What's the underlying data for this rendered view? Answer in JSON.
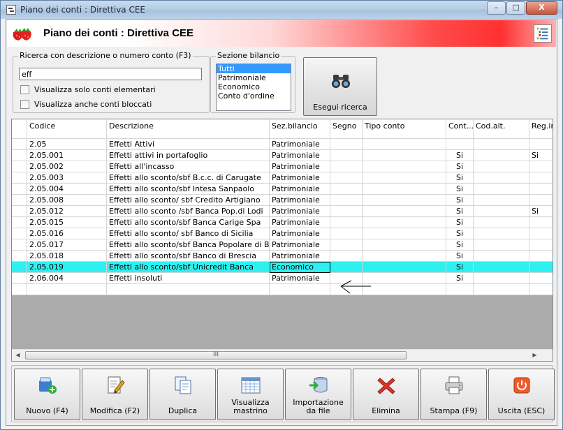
{
  "window": {
    "title": "Piano dei conti : Direttiva CEE",
    "controls": {
      "minimize": "–",
      "maximize": "□",
      "close": "X"
    }
  },
  "header": {
    "title": "Piano dei conti : Direttiva CEE"
  },
  "search": {
    "legend": "Ricerca con descrizione o numero conto (F3)",
    "value": "eff",
    "only_elementary_label": "Visualizza solo conti elementari",
    "show_blocked_label": "Visualizza anche conti bloccati"
  },
  "section": {
    "legend": "Sezione bilancio",
    "options": [
      "Tutti",
      "Patrimoniale",
      "Economico",
      "Conto d'ordine"
    ],
    "selected": "Tutti"
  },
  "search_button": {
    "label": "Esegui ricerca"
  },
  "grid": {
    "columns": [
      "Codice",
      "Descrizione",
      "Sez.bilancio",
      "Segno",
      "Tipo conto",
      "Cont...",
      "Cod.alt.",
      "Reg.ir"
    ],
    "rows": [
      [
        "2.05",
        "Effetti Attivi",
        "Patrimoniale",
        "",
        "",
        "",
        "",
        ""
      ],
      [
        "2.05.001",
        "Effetti attivi in portafoglio",
        "Patrimoniale",
        "",
        "",
        "Si",
        "",
        "Si"
      ],
      [
        "2.05.002",
        "Effetti all'incasso",
        "Patrimoniale",
        "",
        "",
        "Si",
        "",
        ""
      ],
      [
        "2.05.003",
        "Effetti allo sconto/sbf B.c.c. di Carugate",
        "Patrimoniale",
        "",
        "",
        "Si",
        "",
        ""
      ],
      [
        "2.05.004",
        "Effetti allo sconto/sbf Intesa Sanpaolo",
        "Patrimoniale",
        "",
        "",
        "Si",
        "",
        ""
      ],
      [
        "2.05.008",
        "Effetti allo sconto/ sbf Credito Artigiano",
        "Patrimoniale",
        "",
        "",
        "Si",
        "",
        ""
      ],
      [
        "2.05.012",
        "Effetti allo sconto /sbf Banca Pop.di Lodi",
        "Patrimoniale",
        "",
        "",
        "Si",
        "",
        "Si"
      ],
      [
        "2.05.015",
        "Effetti allo sconto/sbf  Banca Carige Spa",
        "Patrimoniale",
        "",
        "",
        "Si",
        "",
        ""
      ],
      [
        "2.05.016",
        "Effetti allo sconto/ sbf  Banco di Sicilia",
        "Patrimoniale",
        "",
        "",
        "Si",
        "",
        ""
      ],
      [
        "2.05.017",
        "Effetti allo sconto/sbf  Banca Popolare di Berg...",
        "Patrimoniale",
        "",
        "",
        "Si",
        "",
        ""
      ],
      [
        "2.05.018",
        "Effetti allo sconto/sbf  Banco di Brescia",
        "Patrimoniale",
        "",
        "",
        "Si",
        "",
        ""
      ],
      [
        "2.05.019",
        "Effetti allo sconto/sbf Unicredit Banca",
        "Economico",
        "",
        "",
        "Si",
        "",
        ""
      ],
      [
        "2.06.004",
        "Effetti insoluti",
        "Patrimoniale",
        "",
        "",
        "Si",
        "",
        ""
      ],
      [
        "",
        "",
        "",
        "",
        "",
        "",
        "",
        ""
      ]
    ],
    "highlight_row": 11,
    "scroll_grip": "III"
  },
  "toolbar": {
    "buttons": [
      {
        "id": "new",
        "label": "Nuovo (F4)",
        "icon": "new-record-icon"
      },
      {
        "id": "edit",
        "label": "Modifica (F2)",
        "icon": "edit-document-icon"
      },
      {
        "id": "duplicate",
        "label": "Duplica",
        "icon": "duplicate-icon"
      },
      {
        "id": "ledger",
        "label": "Visualizza mastrino",
        "icon": "ledger-grid-icon"
      },
      {
        "id": "import",
        "label": "Importazione da file",
        "icon": "database-import-icon"
      },
      {
        "id": "delete",
        "label": "Elimina",
        "icon": "delete-x-icon"
      },
      {
        "id": "print",
        "label": "Stampa (F9)",
        "icon": "printer-icon"
      },
      {
        "id": "exit",
        "label": "Uscita (ESC)",
        "icon": "power-exit-icon"
      }
    ]
  },
  "colors": {
    "highlight_row": "#2ff0f0",
    "list_selection": "#3399ff",
    "header_gradient_end": "#ff3030"
  }
}
